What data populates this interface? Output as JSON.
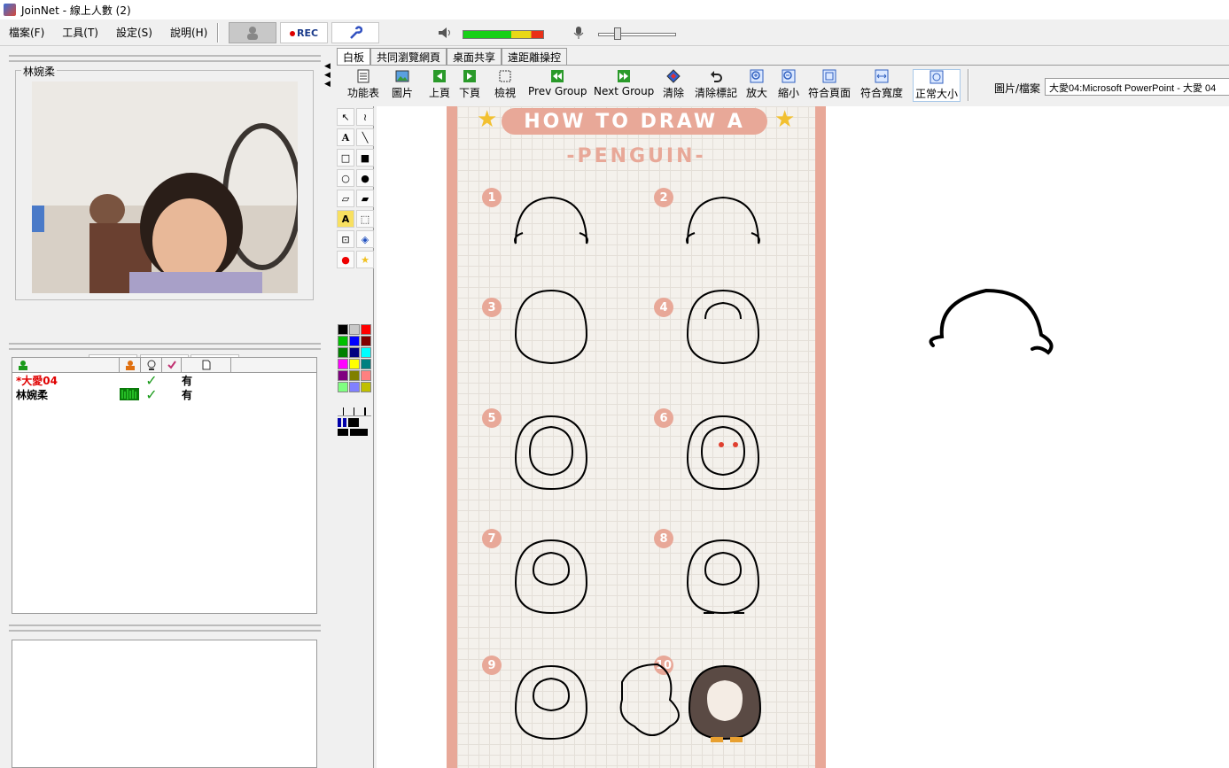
{
  "window": {
    "title": "JoinNet - 線上人數 (2)"
  },
  "menu": {
    "items": [
      "檔案(F)",
      "工具(T)",
      "設定(S)",
      "說明(H)"
    ]
  },
  "toolbar": {
    "rec_label": "REC"
  },
  "video": {
    "name": "林婉柔"
  },
  "users": {
    "rows": [
      {
        "name": "*大愛04",
        "color": "#e00000",
        "has_audio": false,
        "check": "✓",
        "status": "有"
      },
      {
        "name": "林婉柔",
        "color": "#000000",
        "has_audio": true,
        "check": "✓",
        "status": "有"
      }
    ]
  },
  "tabs": [
    "白板",
    "共同瀏覽網頁",
    "桌面共享",
    "遠距離操控"
  ],
  "wb_toolbar": {
    "tools": [
      "功能表",
      "圖片",
      "上頁",
      "下頁",
      "檢視",
      "Prev Group",
      "Next Group",
      "清除",
      "清除標記",
      "放大",
      "縮小",
      "符合頁面",
      "符合寬度",
      "正常大小"
    ],
    "file_label": "圖片/檔案",
    "file_value": "大愛04:Microsoft PowerPoint - 大愛 04"
  },
  "poster": {
    "title": "HOW TO DRAW A",
    "subtitle": "-PENGUIN-",
    "steps": [
      "1",
      "2",
      "3",
      "4",
      "5",
      "6",
      "7",
      "8",
      "9",
      "10"
    ]
  },
  "palette": [
    "#000000",
    "#c8c8c8",
    "#ff0000",
    "#00c000",
    "#0000ff",
    "#800000",
    "#008000",
    "#000080",
    "#00ffff",
    "#ff00ff",
    "#ffff00",
    "#008080",
    "#800080",
    "#808000",
    "#ff8080",
    "#80ff80",
    "#8080ff",
    "#c0c000"
  ]
}
